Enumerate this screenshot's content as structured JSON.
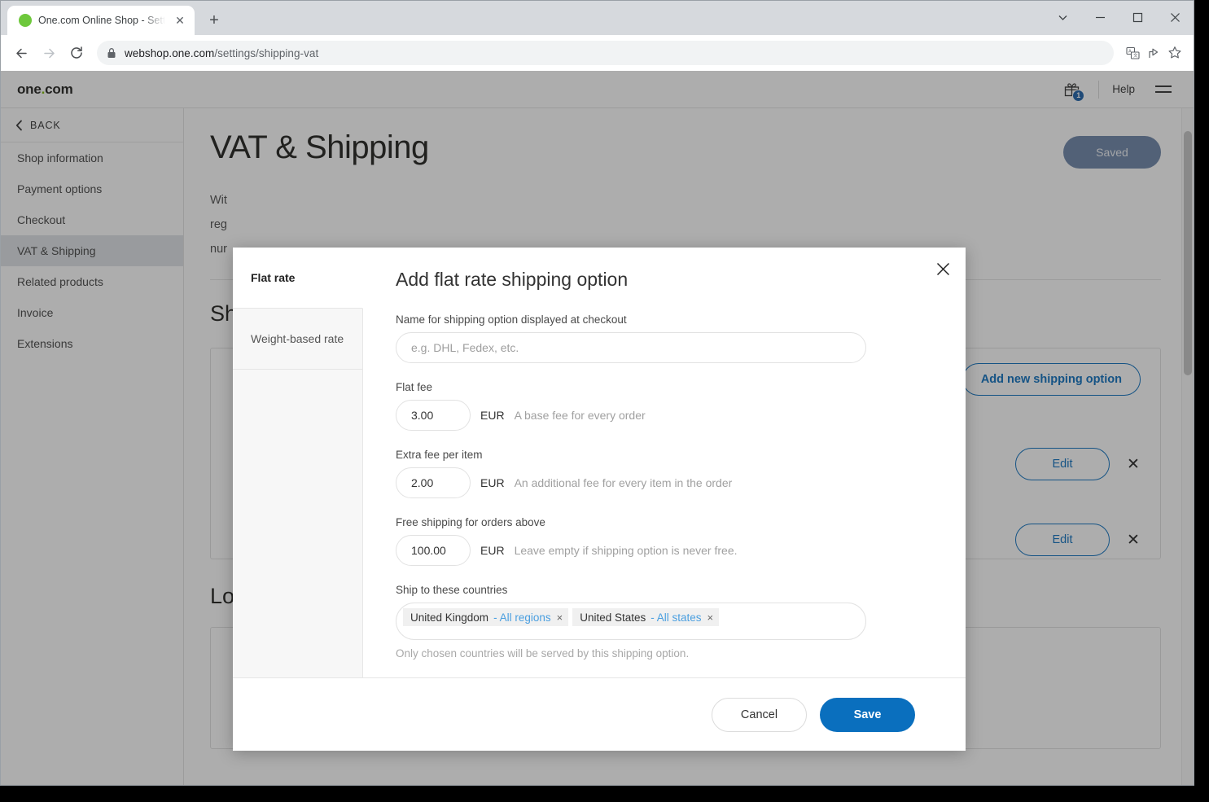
{
  "browser": {
    "tab": {
      "title": "One.com Online Shop - Settings",
      "favicon": "green-circle-icon",
      "close": "✕"
    },
    "new_tab_label": "+",
    "window_controls": {
      "tab_search": "tab-search-icon",
      "minimize": "minimize-icon",
      "maximize": "maximize-icon",
      "close": "close-icon"
    },
    "nav": {
      "back": "back-arrow-icon",
      "forward": "forward-arrow-icon",
      "reload": "reload-icon"
    },
    "url_domain": "webshop.one.com",
    "url_path": "/settings/shipping-vat",
    "omni_icons": [
      "translate-icon",
      "share-icon",
      "bookmark-star-icon"
    ]
  },
  "app_header": {
    "logo": "one",
    "logo_dot": ".",
    "logo_suffix": "com",
    "gift_badge": "1",
    "help_label": "Help",
    "menu": "hamburger-menu-icon"
  },
  "sidebar": {
    "back_label": "BACK",
    "items": [
      {
        "label": "Shop information",
        "active": false
      },
      {
        "label": "Payment options",
        "active": false
      },
      {
        "label": "Checkout",
        "active": false
      },
      {
        "label": "VAT & Shipping",
        "active": true
      },
      {
        "label": "Related products",
        "active": false
      },
      {
        "label": "Invoice",
        "active": false
      },
      {
        "label": "Extensions",
        "active": false
      }
    ]
  },
  "page": {
    "title": "VAT & Shipping",
    "saved_button": "Saved",
    "intro_line1": "Wit",
    "intro_line2": "reg",
    "intro_line3": "nur",
    "section_shipping": "Sh",
    "add_shipping_button": "Add new shipping option",
    "edit_button": "Edit",
    "delete_icon": "✕",
    "section_local_pickup": "Local pickup",
    "shop_illustration": "storefront-icon"
  },
  "modal": {
    "tabs": [
      {
        "label": "Flat rate",
        "active": true
      },
      {
        "label": "Weight-based rate",
        "active": false
      }
    ],
    "close_icon": "✕",
    "title": "Add flat rate shipping option",
    "name_field": {
      "label": "Name for shipping option displayed at checkout",
      "value": "",
      "placeholder": "e.g. DHL, Fedex, etc."
    },
    "flat_fee": {
      "label": "Flat fee",
      "value": "3.00",
      "currency": "EUR",
      "hint": "A base fee for every order"
    },
    "extra_fee": {
      "label": "Extra fee per item",
      "value": "2.00",
      "currency": "EUR",
      "hint": "An additional fee for every item in the order"
    },
    "free_shipping": {
      "label": "Free shipping for orders above",
      "value": "100.00",
      "currency": "EUR",
      "hint": "Leave empty if shipping option is never free."
    },
    "countries": {
      "label": "Ship to these countries",
      "tags": [
        {
          "name": "United Kingdom",
          "region": "- All regions",
          "remove": "×"
        },
        {
          "name": "United States",
          "region": "- All states",
          "remove": "×"
        }
      ],
      "hint": "Only chosen countries will be served by this shipping option."
    },
    "cancel_button": "Cancel",
    "save_button": "Save"
  },
  "colors": {
    "accent_blue": "#0a6fbe",
    "brand_green": "#7ab800",
    "saved_button": "#6d85a8",
    "tag_region": "#4a9fe0"
  }
}
